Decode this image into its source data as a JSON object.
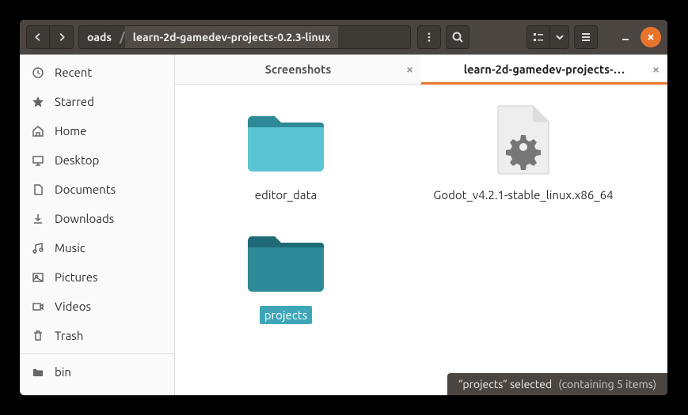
{
  "breadcrumb": {
    "parent": "oads",
    "current": "learn-2d-gamedev-projects-0.2.3-linux"
  },
  "sidebar": {
    "items": [
      {
        "label": "Recent",
        "icon": "clock"
      },
      {
        "label": "Starred",
        "icon": "star"
      },
      {
        "label": "Home",
        "icon": "home"
      },
      {
        "label": "Desktop",
        "icon": "desktop"
      },
      {
        "label": "Documents",
        "icon": "documents"
      },
      {
        "label": "Downloads",
        "icon": "downloads"
      },
      {
        "label": "Music",
        "icon": "music"
      },
      {
        "label": "Pictures",
        "icon": "pictures"
      },
      {
        "label": "Videos",
        "icon": "videos"
      },
      {
        "label": "Trash",
        "icon": "trash"
      }
    ],
    "extra": {
      "label": "bin",
      "icon": "folder"
    }
  },
  "tabs": [
    {
      "label": "Screenshots",
      "active": false
    },
    {
      "label": "learn-2d-gamedev-projects-…",
      "active": true
    }
  ],
  "files": [
    {
      "name": "editor_data",
      "type": "folder",
      "selected": false
    },
    {
      "name": "Godot_v4.2.1-stable_linux.x86_64",
      "type": "executable",
      "selected": false
    },
    {
      "name": "projects",
      "type": "folder",
      "selected": true
    }
  ],
  "status": {
    "main": "“projects” selected",
    "detail": "(containing 5 items)"
  }
}
